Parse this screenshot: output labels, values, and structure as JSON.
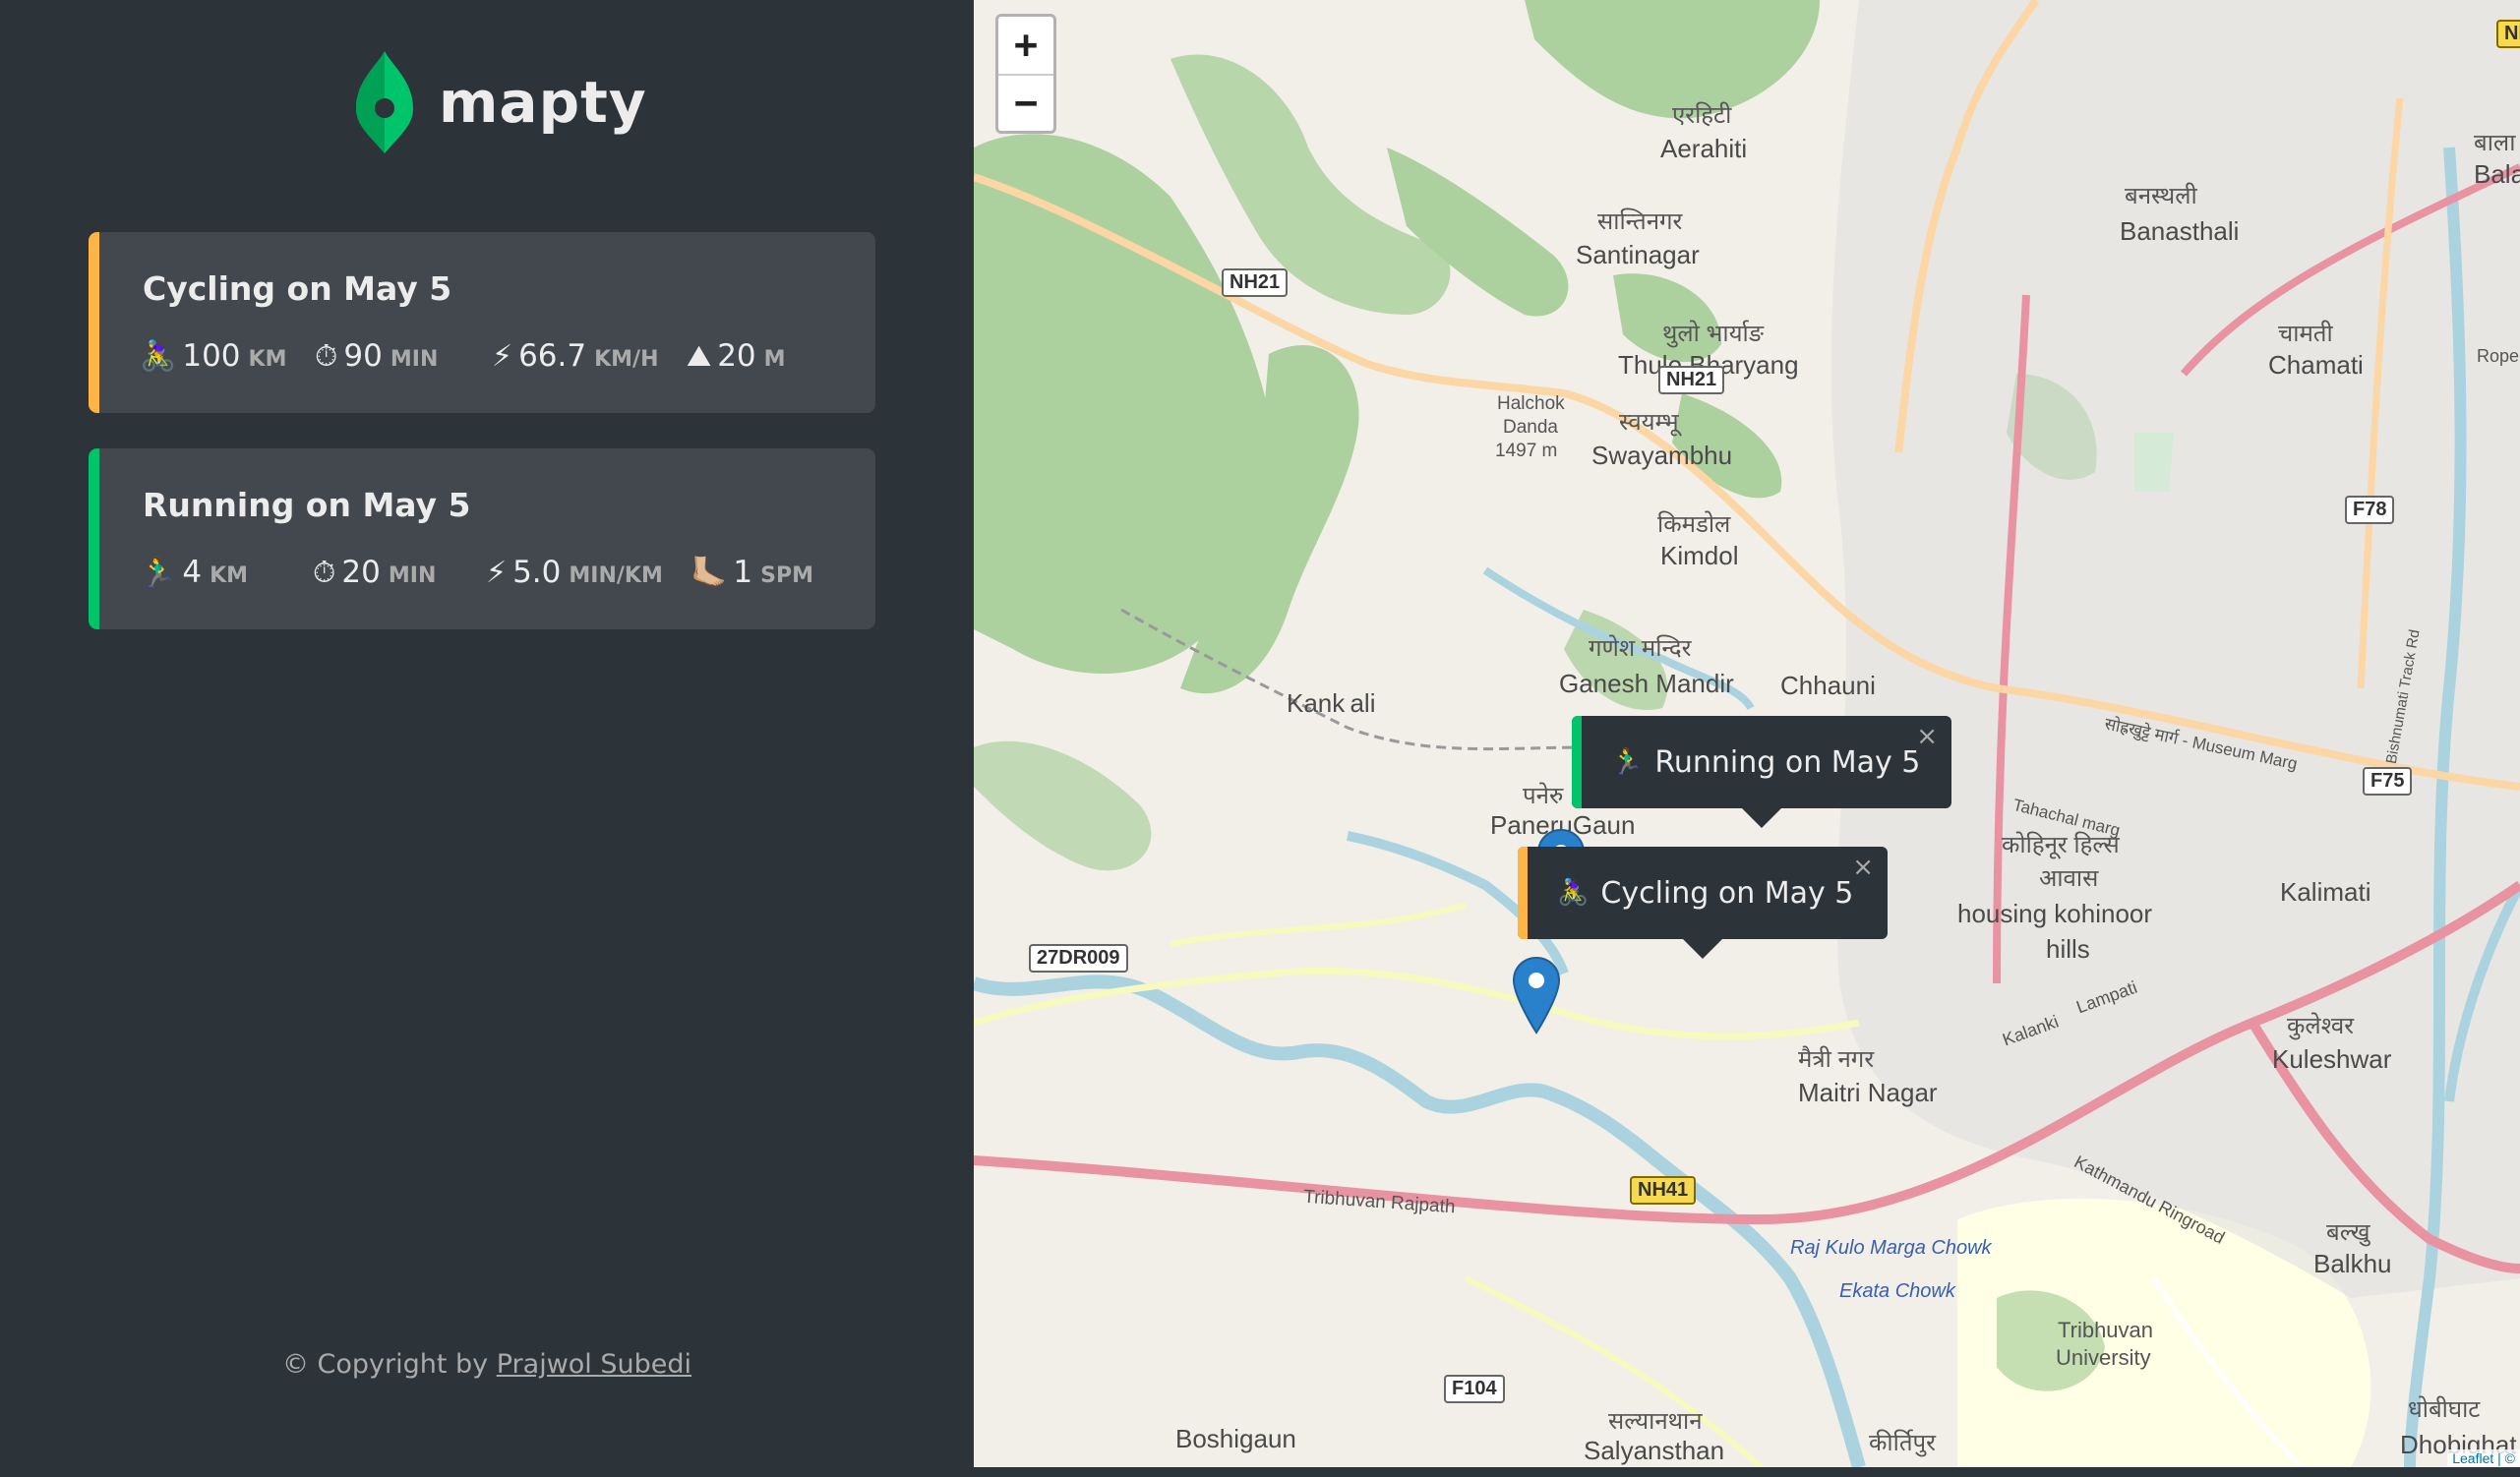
{
  "app": {
    "name": "mapty"
  },
  "workouts": [
    {
      "title": "Cycling on May 5",
      "accent": "#ffb545",
      "stats": [
        {
          "icon": "🚴‍♀️",
          "value": "100",
          "unit": "km"
        },
        {
          "icon": "⏱",
          "value": "90",
          "unit": "min"
        },
        {
          "icon": "⚡",
          "value": "66.7",
          "unit": "km/h"
        },
        {
          "icon": "⛰",
          "value": "20",
          "unit": "m"
        }
      ]
    },
    {
      "title": "Running on May 5",
      "accent": "#00c46a",
      "stats": [
        {
          "icon": "🏃‍♂️",
          "value": "4",
          "unit": "km"
        },
        {
          "icon": "⏱",
          "value": "20",
          "unit": "min"
        },
        {
          "icon": "⚡",
          "value": "5.0",
          "unit": "min/km"
        },
        {
          "icon": "🦶🏼",
          "value": "1",
          "unit": "spm"
        }
      ]
    }
  ],
  "footer": {
    "prefix": "© Copyright by ",
    "author": "Prajwol Subedi"
  },
  "map": {
    "zoom_in": "+",
    "zoom_out": "−",
    "popups": [
      {
        "icon": "🏃‍♂️",
        "text": "Running on May 5",
        "close": "×"
      },
      {
        "icon": "🚴‍♀️",
        "text": "Cycling on May 5",
        "close": "×"
      }
    ],
    "labels": {
      "aerahiti_np": "एरहिटी",
      "aerahiti": "Aerahiti",
      "santinagar_np": "सान्तिनगर",
      "santinagar": "Santinagar",
      "banasthali_np": "बनस्थली",
      "banasthali": "Banasthali",
      "thulo_np": "थुलो भार्याङ",
      "thulo": "Thulo Bharyang",
      "chamati_np": "चामती",
      "chamati": "Chamati",
      "swayambhu_np": "स्वयम्भू",
      "swayambhu": "Swayambhu",
      "kimdol_np": "किमडोल",
      "kimdol": "Kimdol",
      "ganesh_np": "गणेश मन्दिर",
      "ganesh": "Ganesh Mandir",
      "chhauni": "Chhauni",
      "halchok": "Halchok",
      "danda": "Danda",
      "elev": "1497 m",
      "kankali": "Kank ali",
      "paneru_np": "पनेरु",
      "paneru": "PaneruGaun",
      "kohinoor_np": "कोहिनूर हिल्स",
      "awas_np": "आवास",
      "kohinoor": "housing kohinoor",
      "hills": "hills",
      "kalimati": "Kalimati",
      "kuleshwar_np": "कुलेश्वर",
      "kuleshwar": "Kuleshwar",
      "maitri_np": "मैत्री नगर",
      "maitri": "Maitri Nagar",
      "balkhu_np": "बल्खु",
      "balkhu": "Balkhu",
      "tribhuvan": "Tribhuvan",
      "university": "University",
      "rajkulo": "Raj Kulo Marga Chowk",
      "ekata": "Ekata Chowk",
      "tribhuvan_rajpath": "Tribhuvan Rajpath",
      "kathmandu_ringroad": "Kathmandu Ringroad",
      "kalanki": "Kalanki",
      "lampati": "Lampati",
      "tahachal": "Tahachal marg",
      "museum": "सोह्रखुट्टे मार्ग - Museum Marg",
      "bishnumati": "Bishnumati Track Rd",
      "boshigaun": "Boshigaun",
      "salyan_np": "सल्यानथान",
      "salyan": "Salyansthan",
      "kirtipur_np": "कीर्तिपुर",
      "dhobighat_np": "धोबीघाट",
      "dhobighat": "Dhobighat",
      "bala": "बाला",
      "bala2": "Bala",
      "rope": "Rope"
    },
    "shields": {
      "nh21a": "NH21",
      "nh21b": "NH21",
      "nh41": "NH41",
      "f78": "F78",
      "f75": "F75",
      "f104": "F104",
      "r27": "27DR009",
      "nh_top": "NH"
    },
    "attribution": "Leaflet | ©"
  }
}
